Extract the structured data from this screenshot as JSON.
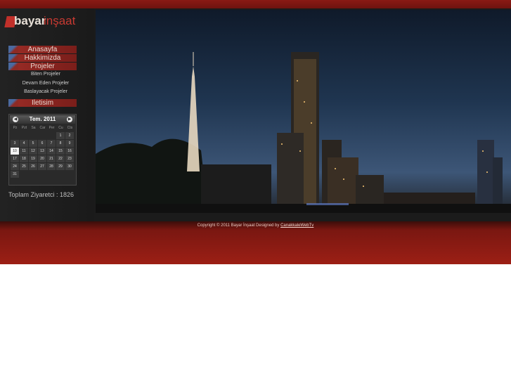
{
  "logo": {
    "part1": "bayar",
    "part2": "inşaat"
  },
  "menu": [
    {
      "label": "Anasayfa"
    },
    {
      "label": "Hakkimizda"
    },
    {
      "label": "Projeler"
    }
  ],
  "submenu": [
    {
      "label": "Biten Projeler"
    },
    {
      "label": "Devam Eden Projeler"
    },
    {
      "label": "Baslayacak Projeler"
    }
  ],
  "contact": {
    "label": "Iletisim"
  },
  "calendar": {
    "title": "Tem. 2011",
    "prev": "◀",
    "next": "▶",
    "days": [
      "Pz",
      "Pzt",
      "Sa",
      "Car",
      "Per",
      "Cu",
      "Cts"
    ],
    "weeks": [
      [
        "",
        "",
        "",
        "",
        "",
        "1",
        "2"
      ],
      [
        "3",
        "4",
        "5",
        "6",
        "7",
        "8",
        "9"
      ],
      [
        "10",
        "11",
        "12",
        "13",
        "14",
        "15",
        "16"
      ],
      [
        "17",
        "18",
        "19",
        "20",
        "21",
        "22",
        "23"
      ],
      [
        "24",
        "25",
        "26",
        "27",
        "28",
        "29",
        "30"
      ],
      [
        "31",
        "",
        "",
        "",
        "",
        "",
        ""
      ]
    ],
    "today": "10"
  },
  "visitors": {
    "text": "Toplam Ziyaretci : 1826"
  },
  "footer": {
    "text": "Copyright © 2011 Bayar İnşaat Designed by",
    "link": "CanakkaleWebTv"
  },
  "colors": {
    "brand_red": "#9a2c26",
    "background": "#1b1b1b"
  }
}
